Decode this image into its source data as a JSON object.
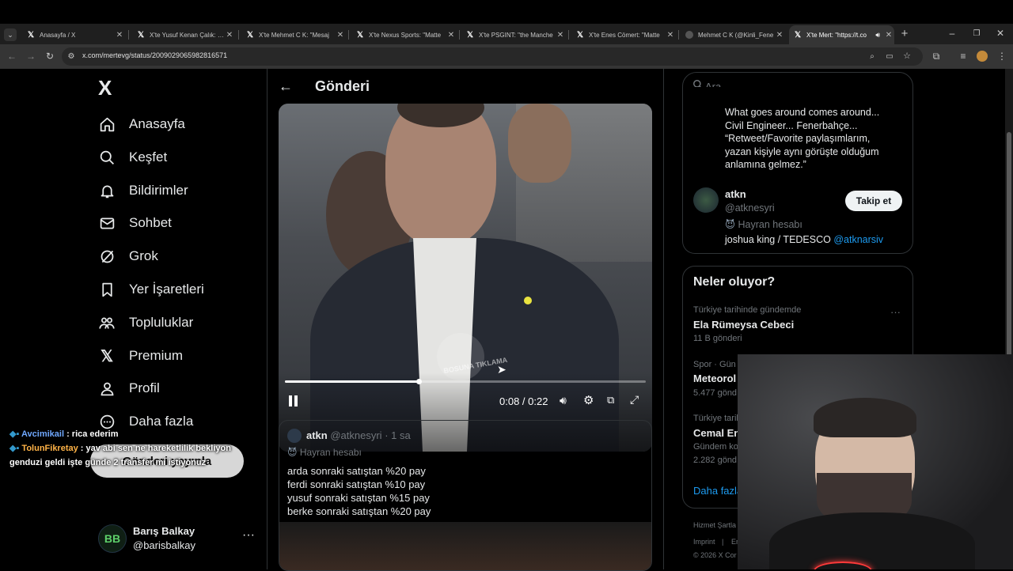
{
  "browser": {
    "tabs": [
      {
        "title": "Anasayfa / X"
      },
      {
        "title": "X'te Yusuf Kenan Çalık: \"Fe"
      },
      {
        "title": "X'te Mehmet C K: \"Mesaj"
      },
      {
        "title": "X'te Nexus Sports: \"Matte"
      },
      {
        "title": "X'te PSGINT: \"the Manche"
      },
      {
        "title": "X'te Enes Cömert: \"Matte"
      },
      {
        "title": "Mehmet C K (@Kinli_Fene"
      },
      {
        "title": "X'te Mert: \"https://t.co"
      }
    ],
    "url": "x.com/mertevg/status/2009029065982816571",
    "new_tab": "+"
  },
  "sidebar": {
    "logo": "X",
    "items": [
      {
        "label": "Anasayfa",
        "icon": "home-icon"
      },
      {
        "label": "Keşfet",
        "icon": "search-icon"
      },
      {
        "label": "Bildirimler",
        "icon": "bell-icon"
      },
      {
        "label": "Sohbet",
        "icon": "mail-icon"
      },
      {
        "label": "Grok",
        "icon": "grok-icon"
      },
      {
        "label": "Yer İşaretleri",
        "icon": "bookmark-icon"
      },
      {
        "label": "Topluluklar",
        "icon": "communities-icon"
      },
      {
        "label": "Premium",
        "icon": "x-premium-icon"
      },
      {
        "label": "Profil",
        "icon": "person-icon"
      },
      {
        "label": "Daha fazla",
        "icon": "more-circle-icon"
      }
    ],
    "post_button": "Gönderi yayınla",
    "account": {
      "name": "Barış Balkay",
      "handle": "@barisbalkay",
      "initials": "BB"
    }
  },
  "main": {
    "header_title": "Gönderi",
    "video": {
      "time": "0:08 / 0:22",
      "progress": 0.37,
      "overlay_text": "BOSUNA TIKLAMA"
    },
    "quoted_post": {
      "name": "atkn",
      "handle": "@atknesyri",
      "time": "· 1 sa",
      "badge": "Hayran hesabı",
      "lines": [
        "arda sonraki satıştan %20 pay",
        "ferdi sonraki satıştan %10 pay",
        "yusuf sonraki satıştan %15 pay",
        "berke sonraki satıştan %20 pay"
      ]
    }
  },
  "right": {
    "search_placeholder": "Ara",
    "bio_lines": [
      "What goes around comes around...",
      "Civil Engineer... Fenerbahçe...",
      "“Retweet/Favorite paylaşımlarım,",
      "yazan kişiyle aynı görüşte olduğum",
      "anlamına gelmez.”"
    ],
    "suggested": {
      "name": "atkn",
      "handle": "@atknesyri",
      "badge": "Hayran hesabı",
      "bio_text": "joshua king / TEDESCO ",
      "bio_link": "@atknarsiv",
      "follow": "Takip et"
    },
    "trends": {
      "title": "Neler oluyor?",
      "items": [
        {
          "context": "Türkiye tarihinde gündemde",
          "name": "Ela Rümeysa Cebeci",
          "count": "11 B gönderi"
        },
        {
          "context": "Spor · Gün",
          "name": "Meteorol",
          "count": "5.477 gönd"
        },
        {
          "context": "Türkiye tarih",
          "name": "Cemal En",
          "count": "Gündem ko",
          "count2": "2.282 gönd"
        }
      ],
      "more": "Daha fazla"
    },
    "footer": [
      "Hizmet Şartla",
      "Imprint",
      "|",
      "Er",
      "© 2026 X Cor"
    ]
  },
  "chat": [
    {
      "user": "Avcimikail",
      "text": " : rica ederim",
      "user_color": "#6fa8ff"
    },
    {
      "user": "TolunFikretay",
      "text": " : yav abi sen ne hareketlilik bekliyon genduzi geldi işte günde 2 transfer mi istiyonuz",
      "user_color": "#ffb347"
    }
  ]
}
